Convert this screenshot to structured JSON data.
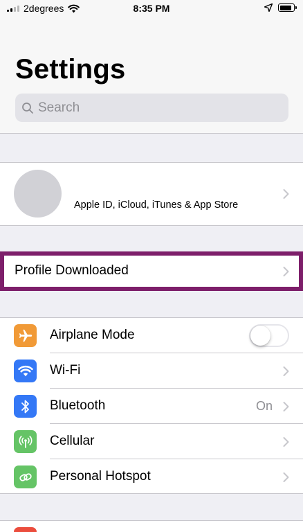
{
  "status_bar": {
    "carrier": "2degrees",
    "time": "8:35 PM"
  },
  "page": {
    "title": "Settings"
  },
  "search": {
    "placeholder": "Search",
    "value": ""
  },
  "profile": {
    "subtitle": "Apple ID, iCloud, iTunes & App Store"
  },
  "profile_downloaded": {
    "label": "Profile Downloaded",
    "highlight_color": "#7d1e6a"
  },
  "network_rows": [
    {
      "label": "Airplane Mode",
      "icon": "airplane-icon",
      "color": "#f19a37",
      "toggle": false
    },
    {
      "label": "Wi-Fi",
      "icon": "wifi-icon",
      "color": "#3478f6"
    },
    {
      "label": "Bluetooth",
      "icon": "bluetooth-icon",
      "color": "#3478f6",
      "value": "On"
    },
    {
      "label": "Cellular",
      "icon": "cellular-antenna-icon",
      "color": "#65c466"
    },
    {
      "label": "Personal Hotspot",
      "icon": "hotspot-link-icon",
      "color": "#65c466"
    }
  ],
  "partial_row": {
    "icon": "notifications-icon",
    "color": "#eb4d3d"
  }
}
